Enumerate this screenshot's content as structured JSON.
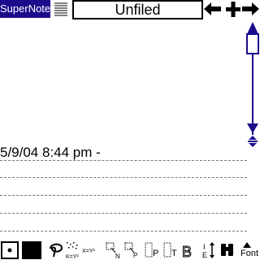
{
  "app": {
    "title": "SuperNote"
  },
  "category": {
    "label": "Unfiled"
  },
  "note": {
    "timestamp": "5/9/04 8:44 pm -"
  },
  "toolbar": {
    "font_label": "Font",
    "text_label": "T",
    "bold_label": "B"
  },
  "colors": {
    "accent": "#1a0d8c",
    "text": "#000000",
    "background": "#ffffff",
    "rule": "#777777"
  },
  "icons": [
    "list-view-icon",
    "arrow-left-icon",
    "plus-icon",
    "arrow-right-icon",
    "scroll-up-icon",
    "scroll-down-icon",
    "scroll-split-icon",
    "dot-tool-icon",
    "fill-black-icon",
    "lasso-icon",
    "scatter-xy-icon",
    "equation-icon",
    "rect-select-n-icon",
    "rect-select-p-icon",
    "pattern-p-icon",
    "pattern-t-icon",
    "bold-tool-icon",
    "text-dir-icon",
    "find-binoculars-icon",
    "font-triangle-icon"
  ]
}
